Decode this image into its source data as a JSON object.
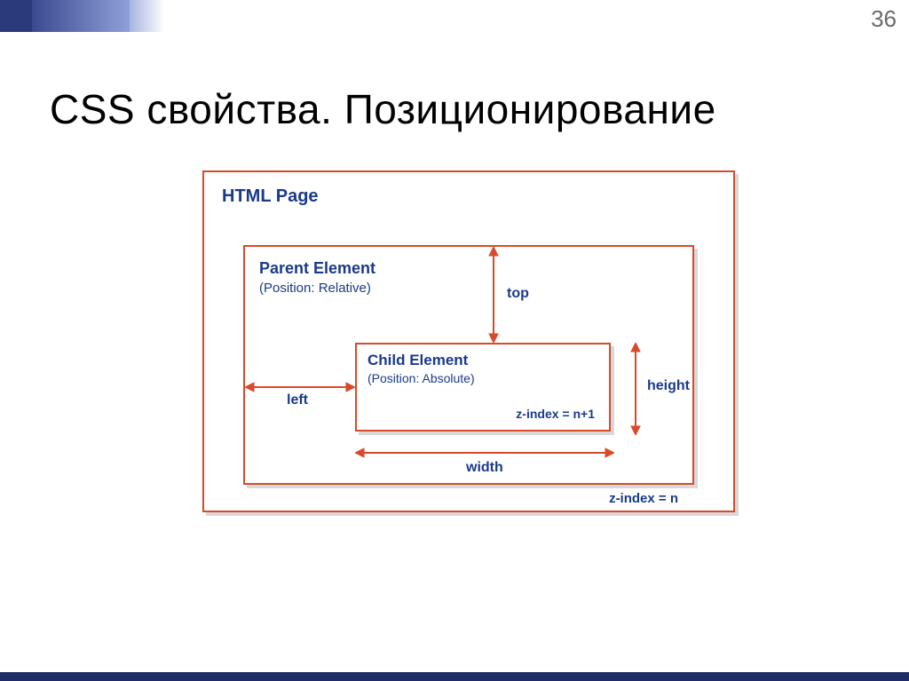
{
  "page_number": "36",
  "title": "CSS свойства. Позиционирование",
  "diagram": {
    "html_page": "HTML Page",
    "parent": {
      "title": "Parent Element",
      "subtitle": "(Position: Relative)",
      "zindex": "z-index = n"
    },
    "child": {
      "title": "Child Element",
      "subtitle": "(Position: Absolute)",
      "zindex": "z-index = n+1"
    },
    "labels": {
      "top": "top",
      "left": "left",
      "height": "height",
      "width": "width"
    }
  }
}
